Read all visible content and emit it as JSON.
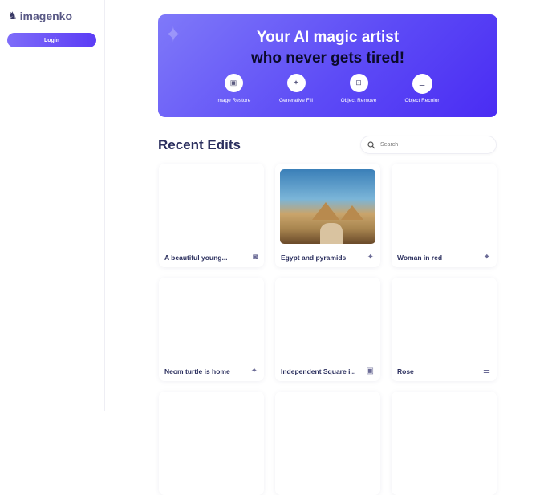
{
  "sidebar": {
    "logo": "imagenko",
    "login_label": "Login"
  },
  "banner": {
    "line1": "Your AI magic artist",
    "line2": "who never gets tired!",
    "tools": [
      {
        "label": "Image Restore",
        "icon": "image-icon"
      },
      {
        "label": "Generative Fill",
        "icon": "sparkles-icon"
      },
      {
        "label": "Object Remove",
        "icon": "scan-icon"
      },
      {
        "label": "Object Recolor",
        "icon": "sliders-icon"
      }
    ]
  },
  "recent": {
    "title": "Recent Edits",
    "search_placeholder": "Search",
    "cards": [
      {
        "name": "A beautiful young...",
        "icon": "camera-icon"
      },
      {
        "name": "Egypt and pyramids",
        "icon": "sparkles-icon"
      },
      {
        "name": "Woman in red",
        "icon": "sparkles-icon"
      },
      {
        "name": "Neom turtle is home",
        "icon": "sparkles-icon"
      },
      {
        "name": "Independent Square i...",
        "icon": "image-icon"
      },
      {
        "name": "Rose",
        "icon": "sliders-icon"
      }
    ]
  }
}
